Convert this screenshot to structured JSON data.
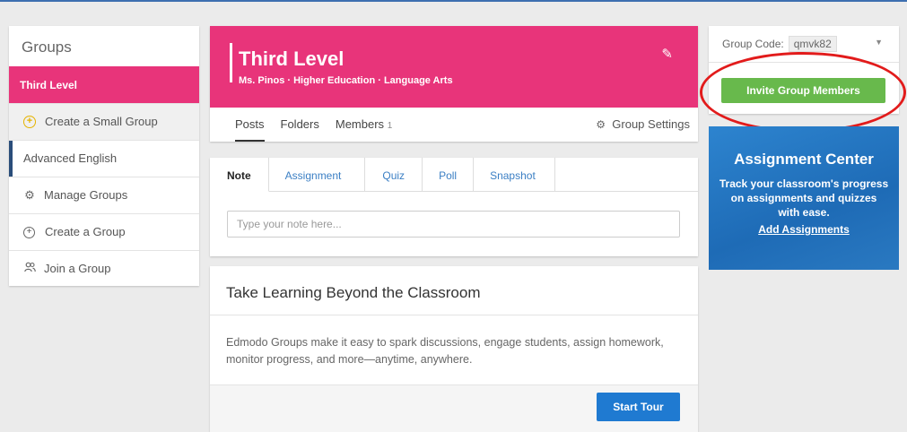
{
  "sidebar": {
    "title": "Groups",
    "items": [
      {
        "label": "Third Level"
      },
      {
        "label": "Create a Small Group",
        "icon": "plus-circle-icon"
      },
      {
        "label": "Advanced English"
      },
      {
        "label": "Manage Groups",
        "icon": "gear-icon"
      },
      {
        "label": "Create a Group",
        "icon": "plus-circle-icon"
      },
      {
        "label": "Join a Group",
        "icon": "people-icon"
      }
    ]
  },
  "header": {
    "title": "Third Level",
    "subtitle": "Ms. Pinos · Higher Education · Language Arts",
    "edit_icon": "pencil-icon",
    "tabs": [
      {
        "label": "Posts"
      },
      {
        "label": "Folders"
      },
      {
        "label": "Members",
        "count": "1"
      }
    ],
    "settings_label": "Group Settings",
    "accent_color": "#e8347a"
  },
  "composer": {
    "tabs": [
      "Note",
      "Assignment",
      "Quiz",
      "Poll",
      "Snapshot"
    ],
    "placeholder": "Type your note here..."
  },
  "info": {
    "title": "Take Learning Beyond the Classroom",
    "body": "Edmodo Groups make it easy to spark discussions, engage students, assign homework, monitor progress, and more—anytime, anywhere.",
    "button": "Start Tour"
  },
  "group_code": {
    "label": "Group Code:",
    "value": "qmvk82",
    "invite_button": "Invite Group Members"
  },
  "assignment_center": {
    "title": "Assignment Center",
    "description": "Track your classroom's progress on assignments and quizzes with ease.",
    "link": "Add Assignments"
  }
}
